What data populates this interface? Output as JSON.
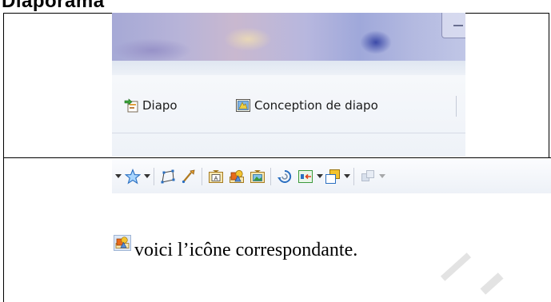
{
  "top_strip": {
    "text": "Diaporama"
  },
  "screenshot": {
    "buttons": [
      {
        "label": "Diapo",
        "icon": "new-slide-icon"
      },
      {
        "label": "Conception de diapo",
        "icon": "slide-design-icon"
      }
    ]
  },
  "toolbar": {
    "icons": [
      "star-shapes-icon",
      "points-icon",
      "glue-points-icon",
      "text-box-icon",
      "insert-image-icon",
      "gallery-image-icon",
      "rotate-icon",
      "align-icon",
      "arrange-icon",
      "extrusion-icon"
    ]
  },
  "caption": {
    "icon": "insert-image-icon",
    "text": "voici l’icône correspondante."
  }
}
